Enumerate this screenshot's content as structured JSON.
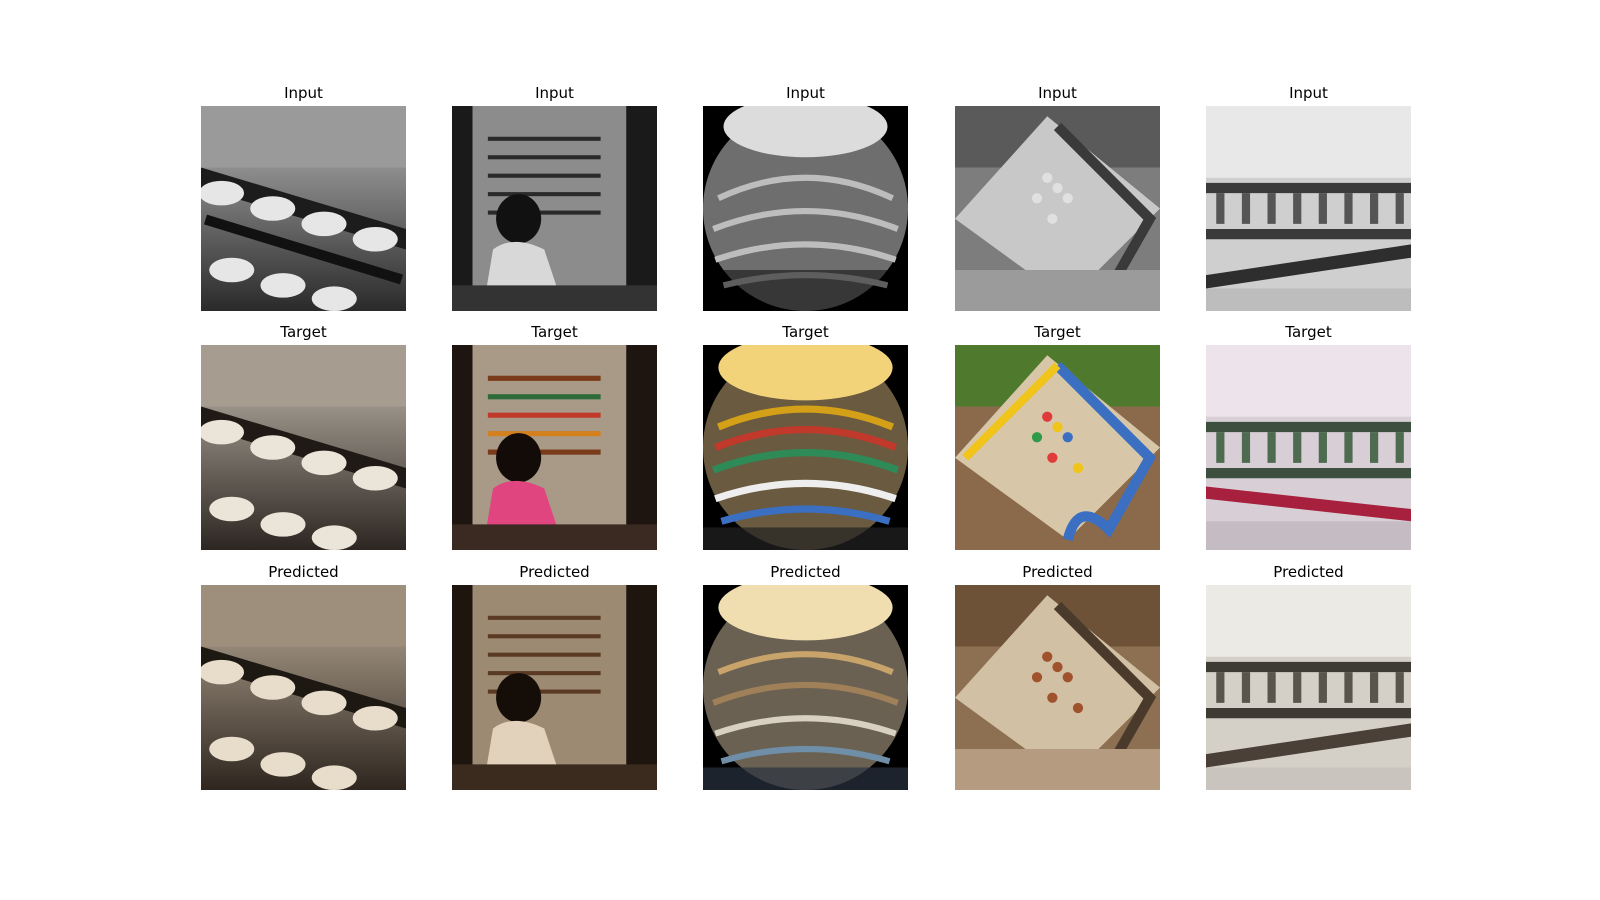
{
  "rows": [
    {
      "label": "Input"
    },
    {
      "label": "Target"
    },
    {
      "label": "Predicted"
    }
  ],
  "columns": [
    {
      "subject": "calculator abacus close-up",
      "icon": "abacus-closeup-photo"
    },
    {
      "subject": "child at large abacus",
      "icon": "child-abacus-photo"
    },
    {
      "subject": "fisheye abacus",
      "icon": "fisheye-abacus-photo"
    },
    {
      "subject": "wooden toy abacus",
      "icon": "toy-abacus-photo"
    },
    {
      "subject": "abacus on lace tablecloth",
      "icon": "lace-abacus-photo"
    }
  ],
  "palette": {
    "input_tone": "#8a8a8a",
    "predicted_tone": "#8d6f52",
    "target_colors": [
      "#6b5b4a",
      "#e0457f",
      "#f2d37a",
      "#3b6fc2",
      "#a7213f"
    ]
  }
}
